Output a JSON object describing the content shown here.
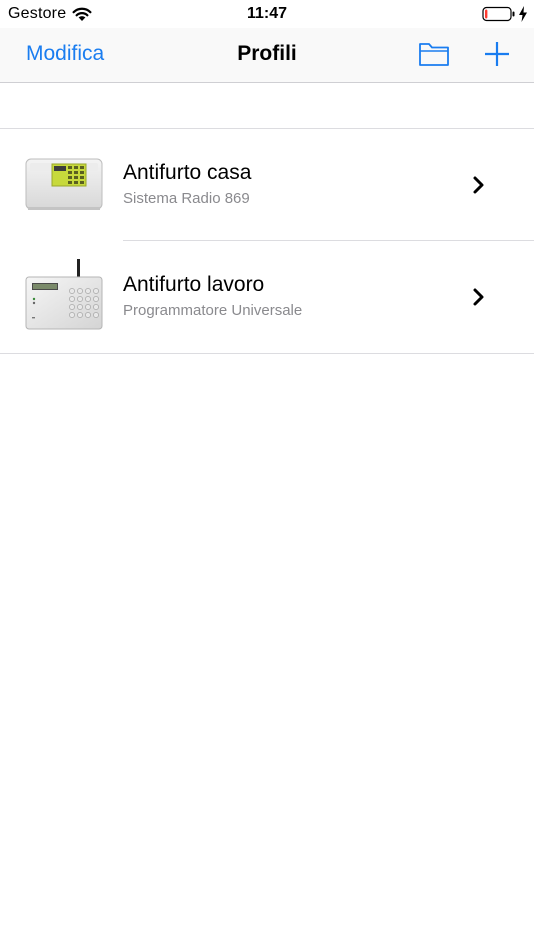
{
  "status_bar": {
    "carrier": "Gestore",
    "time": "11:47",
    "battery_level": 0.1,
    "charging": true,
    "wifi_icon": "wifi-icon",
    "battery_icon": "battery-icon"
  },
  "nav": {
    "edit_label": "Modifica",
    "title": "Profili",
    "folder_icon": "folder-icon",
    "add_icon": "plus-icon",
    "accent_color": "#1a7df0"
  },
  "profiles": [
    {
      "title": "Antifurto casa",
      "subtitle": "Sistema Radio 869",
      "thumbnail": "radio-alarm-panel-image",
      "chevron_icon": "chevron-right-icon"
    },
    {
      "title": "Antifurto lavoro",
      "subtitle": "Programmatore Universale",
      "thumbnail": "keypad-alarm-panel-image",
      "chevron_icon": "chevron-right-icon"
    }
  ]
}
